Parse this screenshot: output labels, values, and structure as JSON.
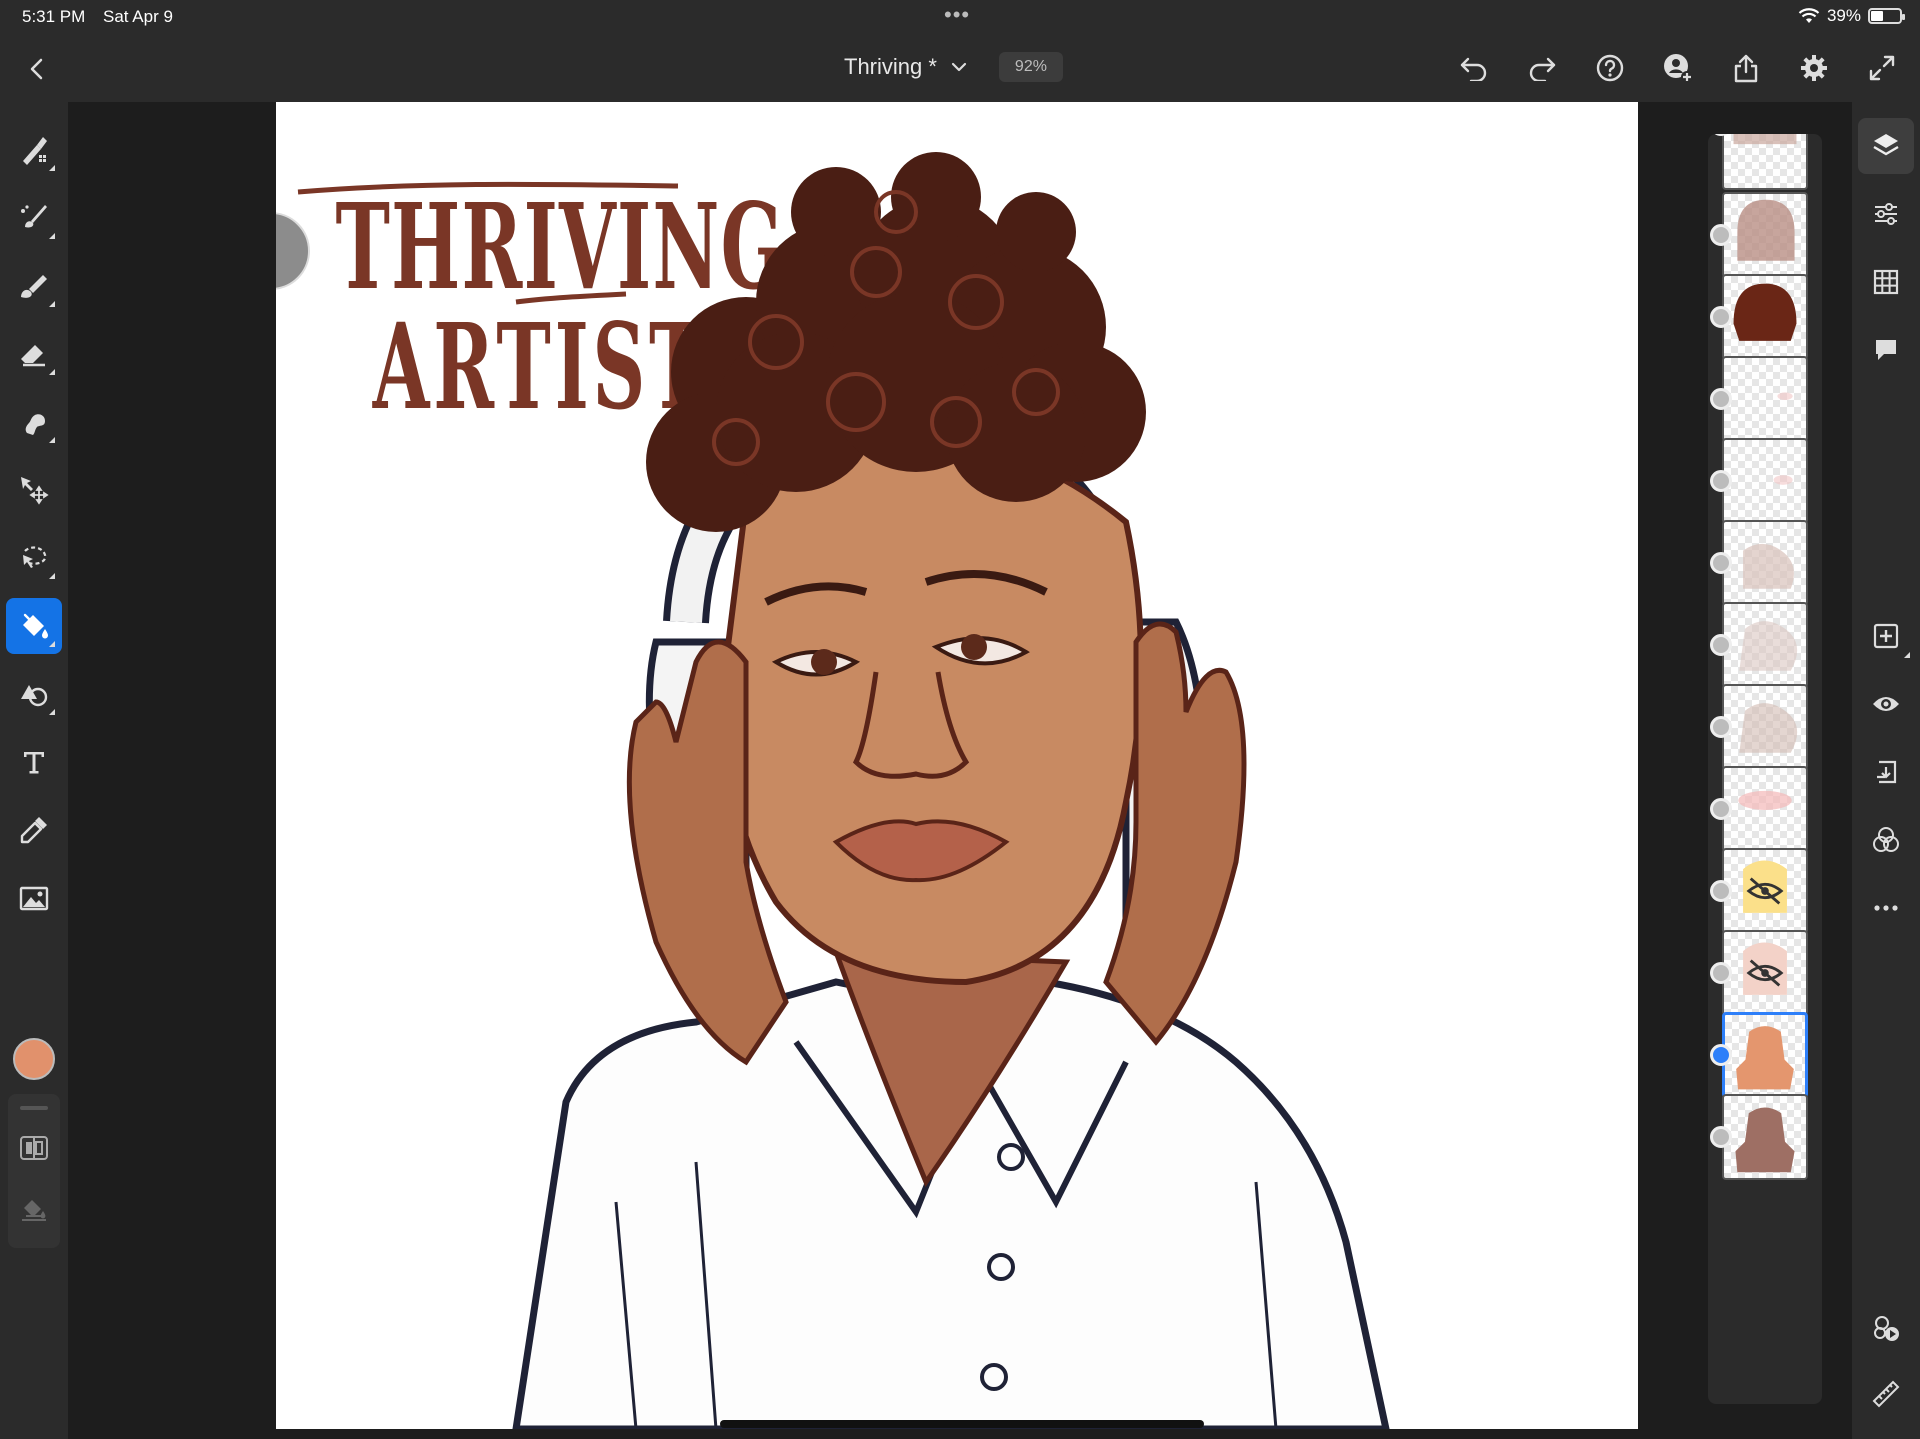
{
  "status_bar": {
    "time": "5:31 PM",
    "date": "Sat Apr 9",
    "battery_label": "39%",
    "battery_level": 0.39,
    "multitask_icon": "ellipsis-icon"
  },
  "toolbar": {
    "document_title": "Thriving *",
    "zoom_label": "92%",
    "actions": [
      "undo-icon",
      "redo-icon",
      "help-icon",
      "invite-icon",
      "share-icon",
      "settings-icon",
      "fullscreen-icon"
    ]
  },
  "tools": [
    "pixel-brush-icon",
    "live-brush-icon",
    "vector-brush-icon",
    "eraser-icon",
    "smudge-icon",
    "transform-icon",
    "selection-icon",
    "fill-icon",
    "shapes-icon",
    "type-icon",
    "eyedropper-icon",
    "image-icon"
  ],
  "active_tool": "fill-icon",
  "current_color": "#e1916c",
  "canvas": {
    "title_line_1": "THRIVING",
    "title_line_2": "ARTIST"
  },
  "layers": {
    "count": 13,
    "selected_index": 11,
    "hidden_indices": [
      9,
      10
    ]
  },
  "right_rail": [
    "layers-icon",
    "adjustments-icon",
    "grid-icon",
    "comments-icon",
    "add-layer-icon",
    "visibility-icon",
    "merge-icon",
    "blend-icon",
    "more-icon",
    "timelapse-icon",
    "ruler-icon"
  ],
  "colors": {
    "accent": "#1473e6",
    "panel": "#2b2b2b",
    "background": "#1d1d1d",
    "title_text": "#7a3626"
  }
}
